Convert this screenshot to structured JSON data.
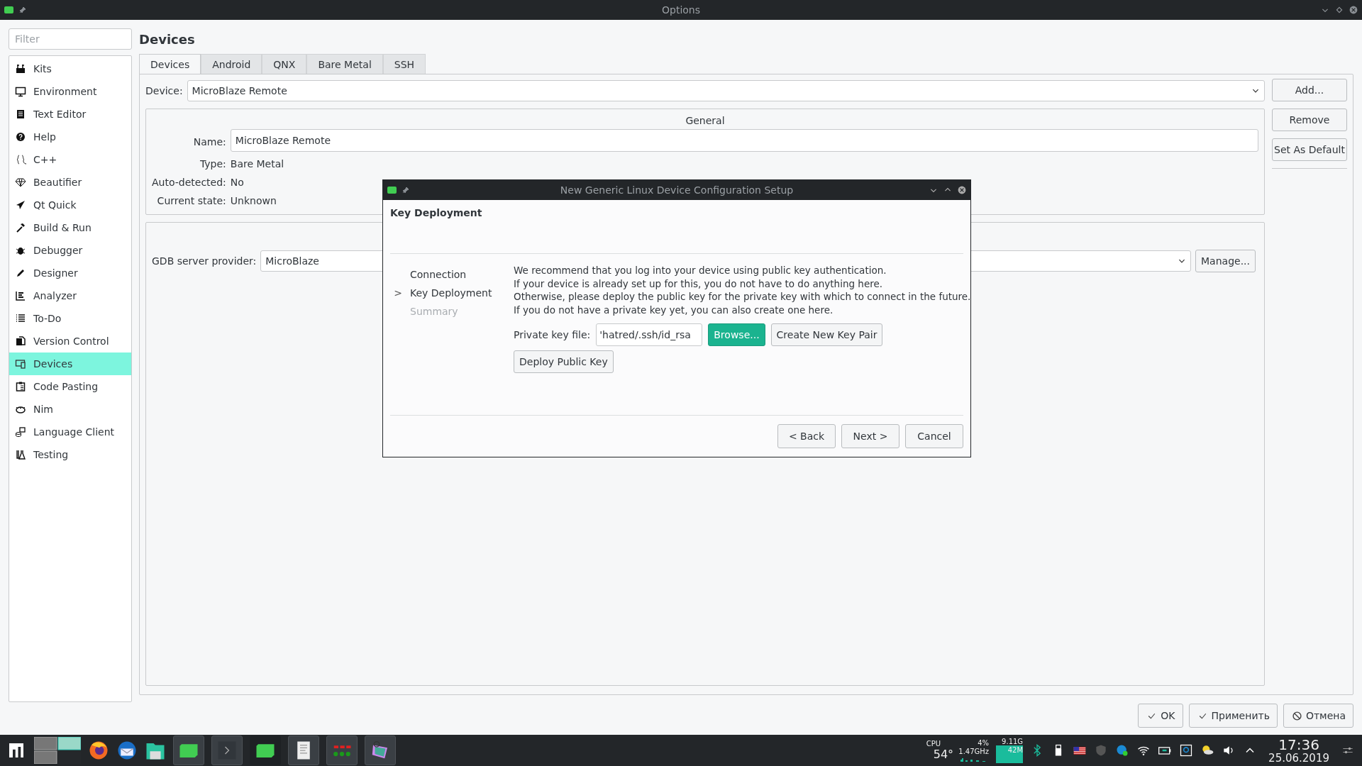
{
  "window": {
    "title": "Options"
  },
  "filter": {
    "placeholder": "Filter"
  },
  "sidebar": {
    "items": [
      {
        "label": "Kits",
        "selected": false
      },
      {
        "label": "Environment",
        "selected": false
      },
      {
        "label": "Text Editor",
        "selected": false
      },
      {
        "label": "Help",
        "selected": false
      },
      {
        "label": "C++",
        "selected": false
      },
      {
        "label": "Beautifier",
        "selected": false
      },
      {
        "label": "Qt Quick",
        "selected": false
      },
      {
        "label": "Build & Run",
        "selected": false
      },
      {
        "label": "Debugger",
        "selected": false
      },
      {
        "label": "Designer",
        "selected": false
      },
      {
        "label": "Analyzer",
        "selected": false
      },
      {
        "label": "To-Do",
        "selected": false
      },
      {
        "label": "Version Control",
        "selected": false
      },
      {
        "label": "Devices",
        "selected": true
      },
      {
        "label": "Code Pasting",
        "selected": false
      },
      {
        "label": "Nim",
        "selected": false
      },
      {
        "label": "Language Client",
        "selected": false
      },
      {
        "label": "Testing",
        "selected": false
      }
    ]
  },
  "page": {
    "heading": "Devices",
    "tabs": [
      {
        "label": "Devices",
        "selected": true
      },
      {
        "label": "Android",
        "selected": false
      },
      {
        "label": "QNX",
        "selected": false
      },
      {
        "label": "Bare Metal",
        "selected": false
      },
      {
        "label": "SSH",
        "selected": false
      }
    ],
    "device_label": "Device:",
    "device_value": "MicroBlaze Remote",
    "side_buttons": [
      "Add...",
      "Remove",
      "Set As Default"
    ],
    "general": {
      "title": "General",
      "fields": [
        {
          "label": "Name:",
          "value": "MicroBlaze Remote",
          "kind": "input"
        },
        {
          "label": "Type:",
          "value": "Bare Metal",
          "kind": "text"
        },
        {
          "label": "Auto-detected:",
          "value": "No",
          "kind": "text"
        },
        {
          "label": "Current state:",
          "value": "Unknown",
          "kind": "text"
        }
      ]
    },
    "gdb": {
      "label": "GDB server provider:",
      "value": "MicroBlaze",
      "button": "Manage..."
    }
  },
  "dialog": {
    "title": "New Generic Linux Device Configuration Setup",
    "heading": "Key Deployment",
    "steps": [
      {
        "label": "Connection",
        "current": false,
        "disabled": false
      },
      {
        "label": "Key Deployment",
        "current": true,
        "disabled": false
      },
      {
        "label": "Summary",
        "current": false,
        "disabled": true
      }
    ],
    "marker": ">",
    "lines": [
      "We recommend that you log into your device using public key authentication.",
      "If your device is already set up for this, you do not have to do anything here.",
      "Otherwise, please deploy the public key for the private key with which to connect in the future.",
      "If you do not have a private key yet, you can also create one here."
    ],
    "key_label": "Private key file:",
    "key_value": "'hatred/.ssh/id_rsa",
    "browse": "Browse...",
    "create": "Create New Key Pair",
    "deploy": "Deploy Public Key",
    "buttons": [
      "< Back",
      "Next >",
      "Cancel"
    ]
  },
  "footer_buttons": [
    {
      "label": "OK",
      "kind": "check"
    },
    {
      "label": "Применить",
      "kind": "check"
    },
    {
      "label": "Отмена",
      "kind": "cancel"
    }
  ],
  "taskbar": {
    "cpu_label": "CPU",
    "temperature": "54°",
    "cpu_load": "4%",
    "frequency": "1.47GHz",
    "mem_total": "9.11G",
    "mem_used": "42M",
    "time": "17:36",
    "date": "25.06.2019"
  }
}
